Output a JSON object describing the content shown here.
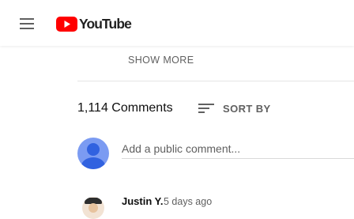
{
  "header": {
    "logo_text": "YouTube",
    "brand_color": "#ff0000"
  },
  "description": {
    "show_more_label": "SHOW MORE"
  },
  "comments": {
    "count_label": "1,114 Comments",
    "sort_label": "SORT BY",
    "add_comment_placeholder": "Add a public comment...",
    "items": [
      {
        "author": "Justin Y.",
        "time": "5 days ago"
      }
    ]
  },
  "colors": {
    "secondary_text": "#606060",
    "avatar_background": "#7b9bf2",
    "avatar_foreground": "#3162e0"
  },
  "icons": [
    "menu-icon",
    "youtube-play-icon",
    "sort-icon",
    "default-avatar-icon"
  ]
}
